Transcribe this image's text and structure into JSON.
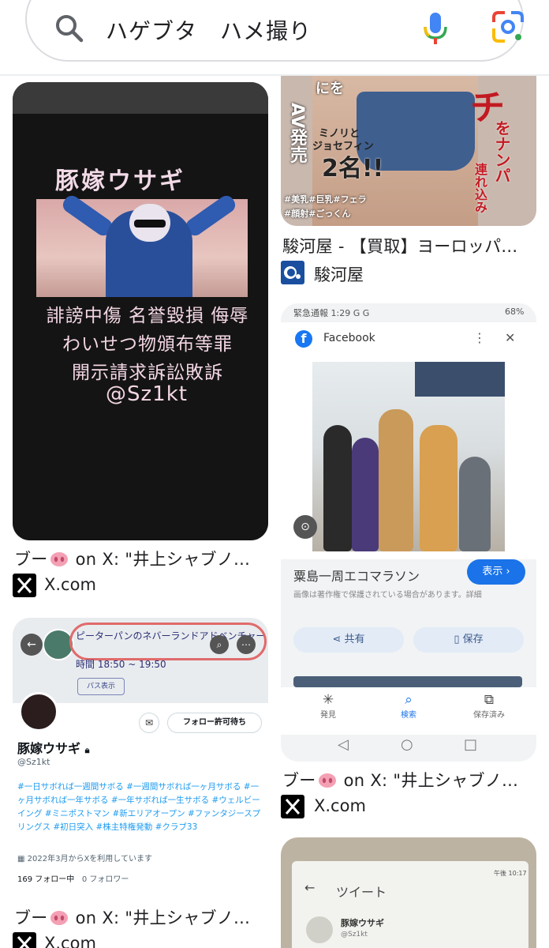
{
  "search": {
    "query": "ハゲブタ　ハメ撮り"
  },
  "colors": {
    "accent_blue": "#1a73e8",
    "text_primary": "#202124",
    "border": "#dadce0"
  },
  "results": [
    {
      "thumb": {
        "title": "豚嫁ウサギ",
        "lines": [
          "誹謗中傷 名誉毀損 侮辱",
          "わいせつ物頒布等罪",
          "開示請求訴訟敗訴"
        ],
        "handle": "@Sz1kt"
      },
      "caption_prefix": "ブー",
      "caption_suffix": " on X: \"井上シャブノ...",
      "source": "X.com",
      "source_icon": "x-logo-icon"
    },
    {
      "thumb": {
        "big": "チ",
        "texts": [
          "にを",
          "AV発売",
          "ミノリと",
          "ジョセフィン",
          "2名!!",
          "をナンパ",
          "連れ込み",
          "#美乳#巨乳#フェラ",
          "#顔射#ごっくん"
        ]
      },
      "caption": "駿河屋 - 【買取】ヨーロッパ...",
      "source": "駿河屋",
      "source_icon": "surugaya-logo-icon"
    },
    {
      "thumb": {
        "status": "緊急通報 1:29 G G",
        "battery": "68%",
        "app": "Facebook",
        "info_title": "粟島一周エコマラソン",
        "show_label": "表示 ›",
        "note": "画像は著作権で保護されている場合があります。詳細",
        "share_label": "共有",
        "save_label": "保存",
        "nav": [
          "発見",
          "検索",
          "保存済み"
        ]
      },
      "caption_prefix": "ブー",
      "caption_suffix": " on X: \"井上シャブノ...",
      "source": "X.com",
      "source_icon": "x-logo-icon"
    },
    {
      "thumb": {
        "event": "ピーターパンのネバーランドアドベンチャー",
        "time": "時間 18:50 ~ 19:50",
        "pass": "パス表示",
        "follow": "フォロー許可待ち",
        "name": "豚嫁ウサギ",
        "uid": "@Sz1kt",
        "bio": "#一日サボれば一週間サボる #一週間サボれば一ヶ月サボる #一ヶ月サボれば一年サボる #一年サボれば一生サボる #ウェルビーイング #ミニポストマン #新エリアオープン #ファンタジースプリングス #初日突入 #株主特権発動 #クラブ33",
        "joined": "2022年3月からXを利用しています",
        "following": "169 フォロー中",
        "followers": "0 フォロワー"
      },
      "caption_prefix": "ブー",
      "caption_suffix": " on X: \"井上シャブノ...",
      "source": "X.com",
      "source_icon": "x-logo-icon"
    },
    {
      "thumb": {
        "title": "ツイート",
        "name": "豚嫁ウサギ",
        "uid": "@Sz1kt",
        "time": "午後 10:17"
      }
    }
  ]
}
